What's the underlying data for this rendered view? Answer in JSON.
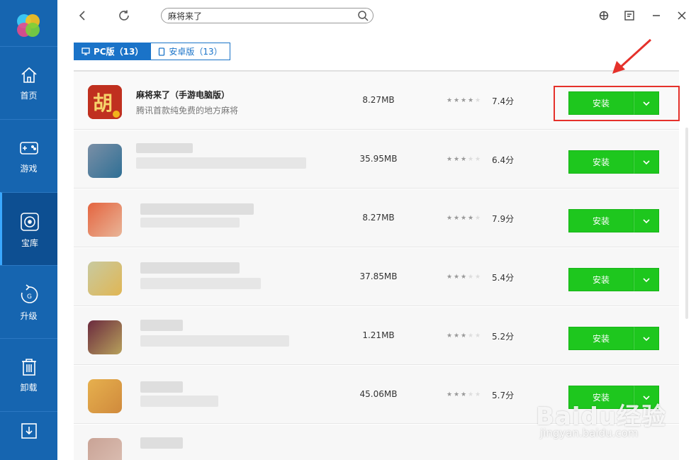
{
  "search": {
    "value": "麻将来了"
  },
  "sidebar": {
    "items": [
      {
        "label": "首页",
        "icon": "home-icon"
      },
      {
        "label": "游戏",
        "icon": "gamepad-icon"
      },
      {
        "label": "宝库",
        "icon": "disc-icon",
        "active": true
      },
      {
        "label": "升级",
        "icon": "upgrade-icon"
      },
      {
        "label": "卸载",
        "icon": "trash-icon"
      },
      {
        "label": "",
        "icon": "download-icon"
      }
    ]
  },
  "tabs": [
    {
      "label": "PC版（13）",
      "icon": "monitor-icon",
      "active": true
    },
    {
      "label": "安卓版（13）",
      "icon": "phone-icon",
      "active": false
    }
  ],
  "apps": [
    {
      "name": "麻将来了（手游电脑版）",
      "desc": "腾讯首款纯免费的地方麻将",
      "size": "8.27MB",
      "rating_stars": 4,
      "score": "7.4分",
      "install_label": "安装"
    },
    {
      "name": "",
      "desc": "",
      "size": "35.95MB",
      "rating_stars": 3,
      "score": "6.4分",
      "install_label": "安装"
    },
    {
      "name": "",
      "desc": "",
      "size": "8.27MB",
      "rating_stars": 4,
      "score": "7.9分",
      "install_label": "安装"
    },
    {
      "name": "",
      "desc": "",
      "size": "37.85MB",
      "rating_stars": 3,
      "score": "5.4分",
      "install_label": "安装"
    },
    {
      "name": "",
      "desc": "",
      "size": "1.21MB",
      "rating_stars": 3,
      "score": "5.2分",
      "install_label": "安装"
    },
    {
      "name": "",
      "desc": "",
      "size": "45.06MB",
      "rating_stars": 3,
      "score": "5.7分",
      "install_label": "安装"
    }
  ],
  "watermark": {
    "brand": "Baidu经验",
    "url": "jingyan.baidu.com"
  },
  "colors": {
    "sidebar": "#1665b0",
    "accent": "#1a73c8",
    "install": "#1ec71e",
    "highlight": "#e5312b"
  }
}
